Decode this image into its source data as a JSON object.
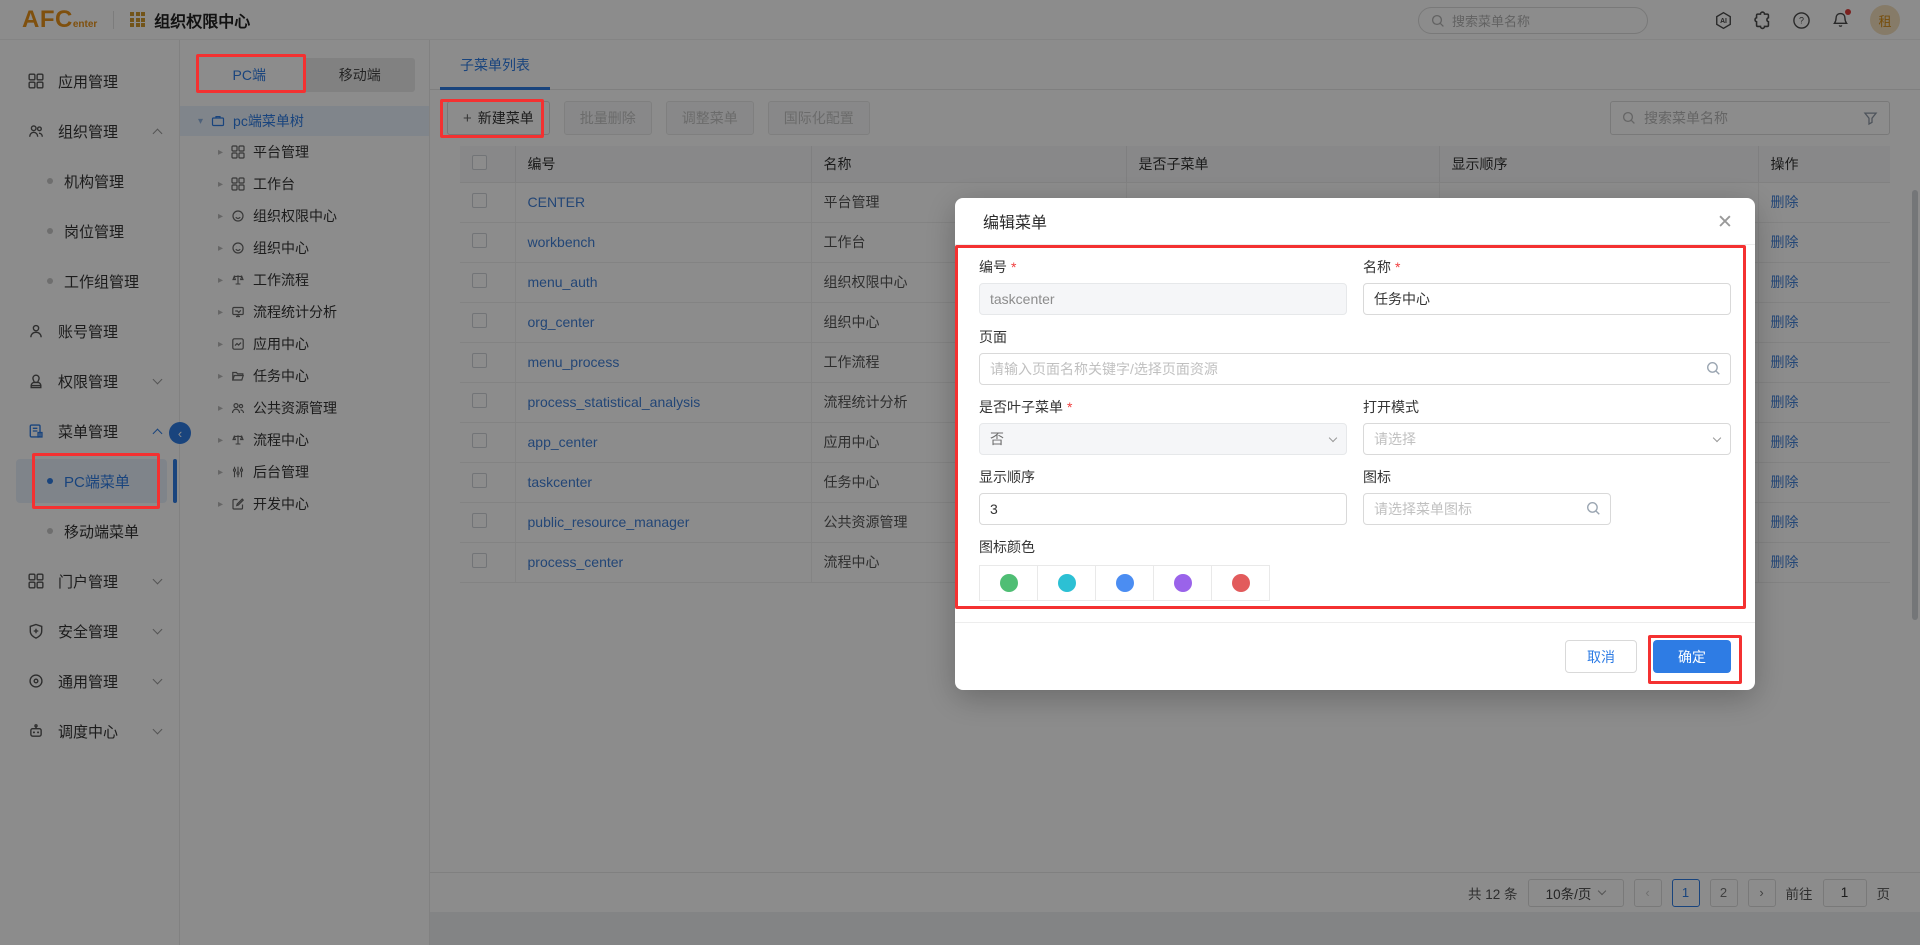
{
  "header": {
    "logo_text": "AFC",
    "logo_suffix": "enter",
    "app_title": "组织权限中心",
    "search_placeholder": "搜索菜单名称",
    "avatar_text": "租"
  },
  "sidebar": {
    "items": [
      {
        "label": "应用管理"
      },
      {
        "label": "组织管理"
      },
      {
        "label": "机构管理"
      },
      {
        "label": "岗位管理"
      },
      {
        "label": "工作组管理"
      },
      {
        "label": "账号管理"
      },
      {
        "label": "权限管理"
      },
      {
        "label": "菜单管理"
      },
      {
        "label": "PC端菜单"
      },
      {
        "label": "移动端菜单"
      },
      {
        "label": "门户管理"
      },
      {
        "label": "安全管理"
      },
      {
        "label": "通用管理"
      },
      {
        "label": "调度中心"
      }
    ]
  },
  "tree": {
    "tab_pc": "PC端",
    "tab_mobile": "移动端",
    "root": "pc端菜单树",
    "items": [
      "平台管理",
      "工作台",
      "组织权限中心",
      "组织中心",
      "工作流程",
      "流程统计分析",
      "应用中心",
      "任务中心",
      "公共资源管理",
      "流程中心",
      "后台管理",
      "开发中心"
    ]
  },
  "main": {
    "tab_label": "子菜单列表",
    "toolbar": {
      "new_menu": "新建菜单",
      "batch_delete": "批量删除",
      "adjust_menu": "调整菜单",
      "i18n_config": "国际化配置",
      "search_placeholder": "搜索菜单名称"
    },
    "table": {
      "headers": {
        "code": "编号",
        "name": "名称",
        "is_sub": "是否子菜单",
        "order": "显示顺序",
        "action": "操作"
      },
      "action_label": "删除",
      "rows": [
        {
          "code": "CENTER",
          "name": "平台管理"
        },
        {
          "code": "workbench",
          "name": "工作台"
        },
        {
          "code": "menu_auth",
          "name": "组织权限中心"
        },
        {
          "code": "org_center",
          "name": "组织中心"
        },
        {
          "code": "menu_process",
          "name": "工作流程"
        },
        {
          "code": "process_statistical_analysis",
          "name": "流程统计分析"
        },
        {
          "code": "app_center",
          "name": "应用中心"
        },
        {
          "code": "taskcenter",
          "name": "任务中心"
        },
        {
          "code": "public_resource_manager",
          "name": "公共资源管理"
        },
        {
          "code": "process_center",
          "name": "流程中心"
        }
      ]
    },
    "pagination": {
      "total": "共 12 条",
      "page_size": "10条/页",
      "prev": "‹",
      "page1": "1",
      "page2": "2",
      "next": "›",
      "goto_label": "前往",
      "goto_value": "1",
      "unit": "页"
    }
  },
  "modal": {
    "title": "编辑菜单",
    "code_label": "编号",
    "code_value": "taskcenter",
    "name_label": "名称",
    "name_value": "任务中心",
    "page_label": "页面",
    "page_placeholder": "请输入页面名称关键字/选择页面资源",
    "leaf_label": "是否叶子菜单",
    "leaf_value": "否",
    "open_label": "打开模式",
    "open_placeholder": "请选择",
    "order_label": "显示顺序",
    "order_value": "3",
    "icon_label": "图标",
    "icon_placeholder": "请选择菜单图标",
    "color_label": "图标颜色",
    "colors": [
      "#4fbe74",
      "#2cc0d4",
      "#4b8df2",
      "#9a63ea",
      "#e25b5c"
    ],
    "cancel_label": "取消",
    "confirm_label": "确定"
  },
  "annotation_color": "#f43131"
}
